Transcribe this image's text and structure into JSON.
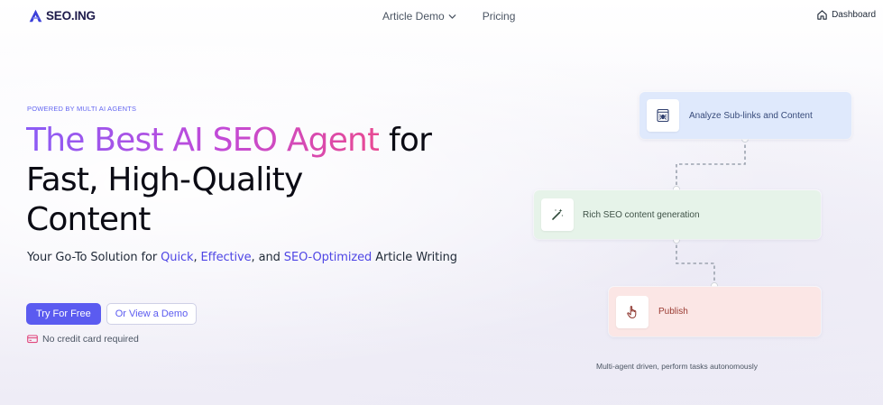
{
  "brand": {
    "name": "SEO.ING",
    "accent": "#4f46e5",
    "primary_button_color": "#5b5bf0"
  },
  "nav": {
    "items": [
      {
        "label": "Article Demo",
        "icon": "chevron-down-icon"
      },
      {
        "label": "Pricing"
      }
    ],
    "dashboard_label": "Dashboard",
    "dashboard_icon": "home-icon"
  },
  "hero": {
    "eyebrow": "POWERED BY MULTI AI AGENTS",
    "headline_gradient": "The Best AI SEO Agent",
    "headline_rest_1": "for",
    "headline_line_2": "Fast, High-Quality",
    "headline_line_3": "Content",
    "gradient_colors": [
      "#8b5cf6",
      "#c24ad8",
      "#e84a93"
    ],
    "subhead": {
      "part1": "Your Go-To Solution for ",
      "hl1": "Quick",
      "sep1": ", ",
      "hl2": "Effective",
      "sep2": ", and ",
      "hl3": "SEO-Optimized",
      "part2": " Article Writing"
    },
    "primary_cta": "Try For Free",
    "secondary_cta": "Or View a Demo",
    "note": "No credit card required",
    "note_icon": "credit-card-icon"
  },
  "workflow": {
    "steps": [
      {
        "label": "Analyze Sub-links and Content",
        "icon": "spider-icon",
        "color": "#dfe9fc"
      },
      {
        "label": "Rich SEO content generation",
        "icon": "magic-wand-icon",
        "color": "#e6f3e9"
      },
      {
        "label": "Publish",
        "icon": "hand-pointer-icon",
        "color": "#fbe6e5"
      }
    ],
    "caption": "Multi-agent driven, perform tasks autonomously"
  }
}
